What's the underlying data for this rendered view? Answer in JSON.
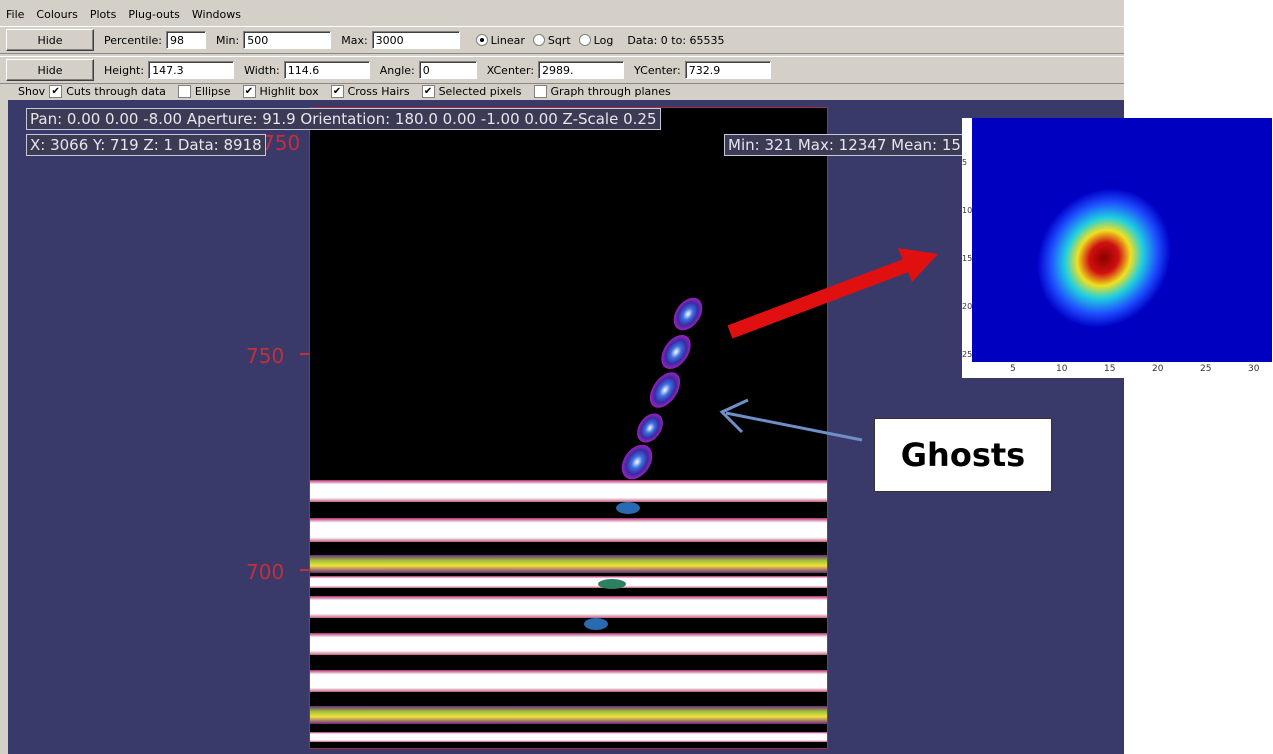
{
  "menu": [
    "File",
    "Colours",
    "Plots",
    "Plug-outs",
    "Windows"
  ],
  "toolbar1": {
    "hide_label": "Hide",
    "percentile_label": "Percentile:",
    "percentile_value": "98",
    "min_label": "Min:",
    "min_value": "500",
    "max_label": "Max:",
    "max_value": "3000",
    "scale_options": [
      "Linear",
      "Sqrt",
      "Log"
    ],
    "scale_selected": "Linear",
    "data_range": "Data: 0 to: 65535"
  },
  "toolbar2": {
    "hide_label": "Hide",
    "height_label": "Height:",
    "height_value": "147.3",
    "width_label": "Width:",
    "width_value": "114.6",
    "angle_label": "Angle:",
    "angle_value": "0",
    "xcenter_label": "XCenter:",
    "xcenter_value": "2989.",
    "ycenter_label": "YCenter:",
    "ycenter_value": "732.9"
  },
  "show_row": {
    "show_label": "Shov",
    "options": [
      {
        "label": "Cuts through data",
        "checked": "✔"
      },
      {
        "label": "Ellipse",
        "checked": ""
      },
      {
        "label": "Highlit box",
        "checked": "✔"
      },
      {
        "label": "Cross Hairs",
        "checked": "✔"
      },
      {
        "label": "Selected pixels",
        "checked": "✔"
      },
      {
        "label": "Graph through planes",
        "checked": ""
      }
    ]
  },
  "overlays": {
    "pan": "Pan: 0.00 0.00 -8.00 Aperture: 91.9 Orientation: 180.0 0.00 -1.00 0.00 Z-Scale 0.25",
    "cursor": "X: 3066 Y: 719 Z: 1 Data: 8918",
    "stats": "Min: 321 Max: 12347 Mean: 15"
  },
  "y_axis_labels": [
    "750",
    "750",
    "700"
  ],
  "inset": {
    "x_ticks": [
      "5",
      "10",
      "15",
      "20",
      "25",
      "30"
    ],
    "y_ticks": [
      "5",
      "10",
      "15",
      "20",
      "25"
    ]
  },
  "annotation": {
    "label": "Ghosts"
  },
  "colors": {
    "window_bg": "#d4d0c8",
    "canvas_bg": "#3a3a6a",
    "arrow_red": "#e01010",
    "arrow_blue": "#6f8fc8"
  }
}
